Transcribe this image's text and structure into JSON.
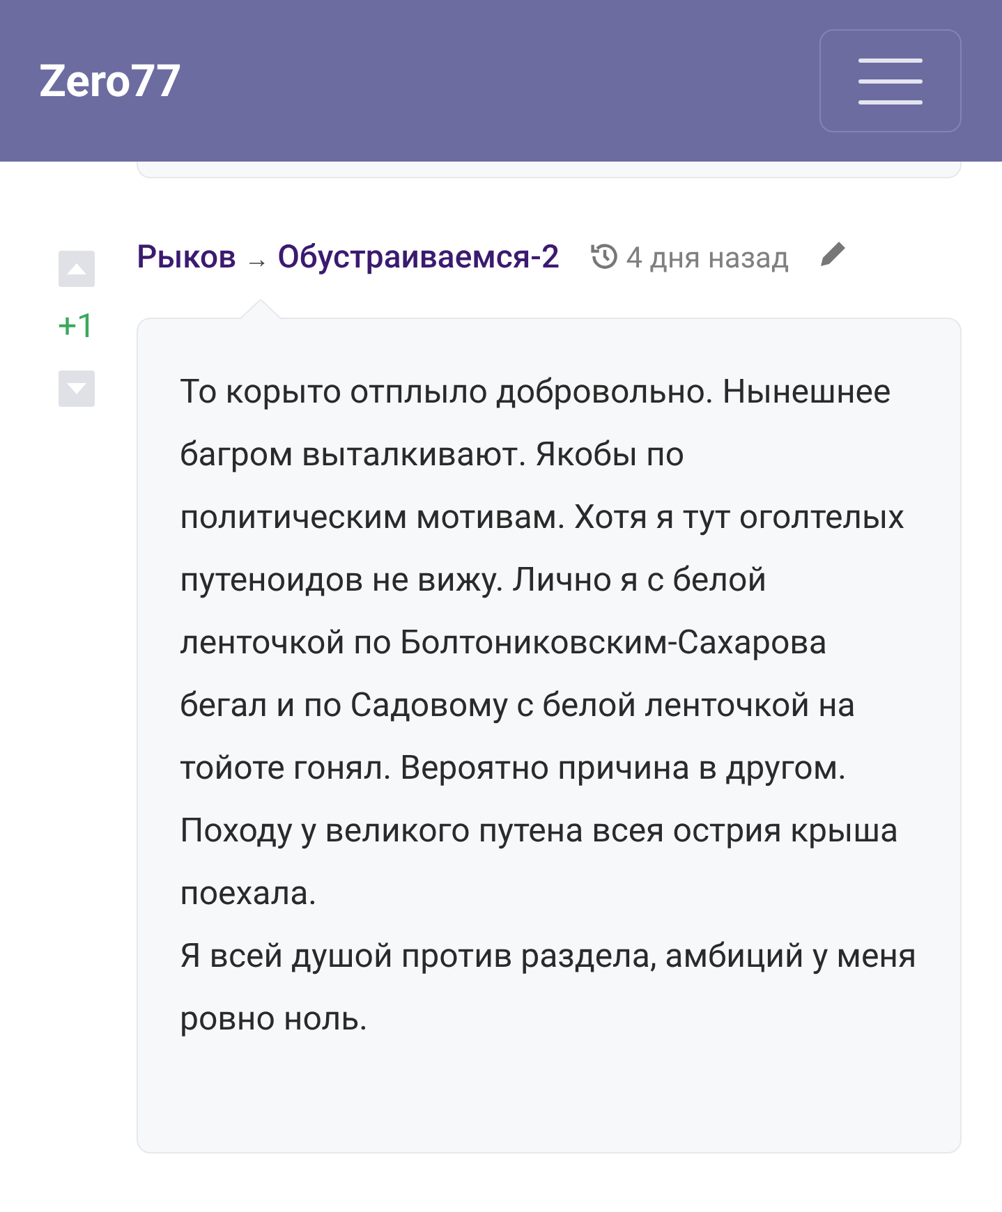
{
  "header": {
    "title": "Zero77"
  },
  "comment": {
    "score": "+1",
    "author": "Рыков",
    "arrow": "→",
    "topic": "Обустраиваемся-2",
    "time": "4 дня назад",
    "paragraphs": [
      "То корыто отплыло добровольно. Нынешнее багром выталкивают. Якобы по политическим мотивам. Хотя я тут оголтелых путеноидов не вижу. Лично я с белой ленточкой по Болтониковским-Сахарова бегал и по Садовому с белой ленточкой на тойоте гонял. Вероятно причина в другом. Походу у великого путена всея острия крыша поехала.",
      "Я всей душой против раздела, амбиций у меня ровно ноль."
    ]
  }
}
